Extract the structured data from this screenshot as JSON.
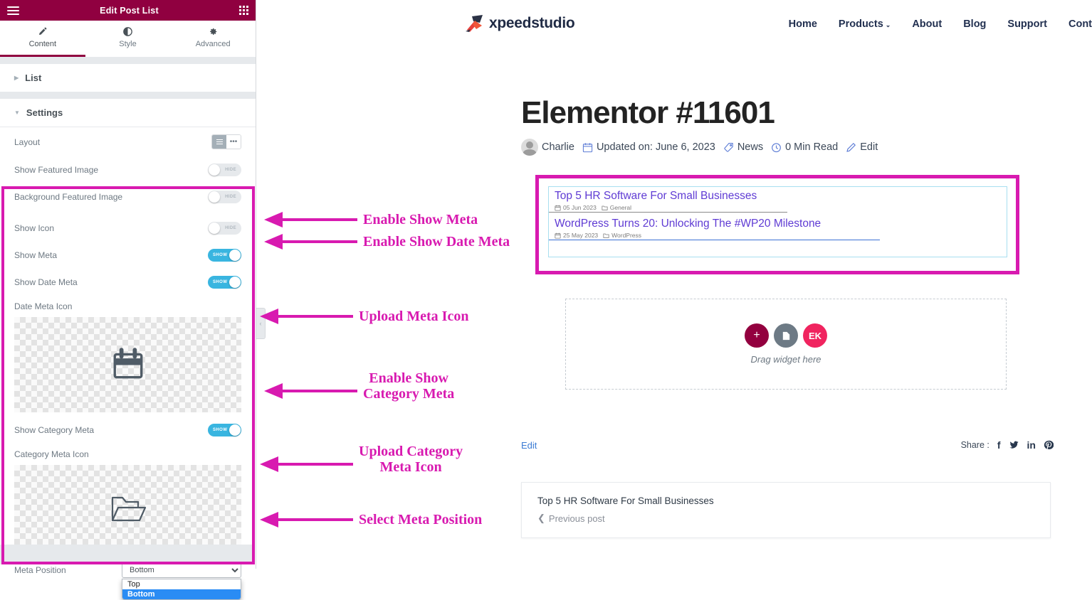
{
  "panel": {
    "title": "Edit Post List",
    "menu_icon": "hamburger-icon",
    "grid_icon": "grid-apps-icon",
    "tabs": [
      {
        "label": "Content",
        "icon": "pencil-icon",
        "active": true
      },
      {
        "label": "Style",
        "icon": "contrast-icon",
        "active": false
      },
      {
        "label": "Advanced",
        "icon": "gear-icon",
        "active": false
      }
    ],
    "sections": [
      {
        "label": "List",
        "expanded": false
      },
      {
        "label": "Settings",
        "expanded": true
      }
    ],
    "controls": {
      "layout": {
        "label": "Layout",
        "options": [
          "list",
          "grid"
        ],
        "selected": "list"
      },
      "show_featured_image": {
        "label": "Show Featured Image",
        "state": "HIDE"
      },
      "background_featured_image": {
        "label": "Background Featured Image",
        "state": "HIDE"
      },
      "show_icon": {
        "label": "Show Icon",
        "state": "HIDE"
      },
      "show_meta": {
        "label": "Show Meta",
        "state": "SHOW"
      },
      "show_date_meta": {
        "label": "Show Date Meta",
        "state": "SHOW"
      },
      "date_meta_icon": {
        "label": "Date Meta Icon",
        "icon": "calendar-icon"
      },
      "show_category_meta": {
        "label": "Show Category Meta",
        "state": "SHOW"
      },
      "category_meta_icon": {
        "label": "Category Meta Icon",
        "icon": "folder-open-icon"
      },
      "meta_position": {
        "label": "Meta Position",
        "value": "Bottom",
        "options": [
          "Top",
          "Bottom"
        ],
        "open": true
      }
    },
    "collapse_handle": "‹",
    "highlight_color": "#d81ab0"
  },
  "annotations": [
    {
      "text": "Enable Show Meta"
    },
    {
      "text": "Enable Show Date Meta"
    },
    {
      "text": "Upload Meta Icon"
    },
    {
      "text": "Enable Show\nCategory Meta"
    },
    {
      "text": "Upload Category\nMeta Icon"
    },
    {
      "text": "Select Meta Position"
    }
  ],
  "site": {
    "logo_text": "xpeedstudio",
    "nav": [
      {
        "label": "Home",
        "dropdown": false
      },
      {
        "label": "Products",
        "dropdown": true
      },
      {
        "label": "About",
        "dropdown": false
      },
      {
        "label": "Blog",
        "dropdown": false
      },
      {
        "label": "Support",
        "dropdown": false
      },
      {
        "label": "Cont",
        "dropdown": false
      }
    ],
    "post": {
      "title": "Elementor #11601",
      "meta": [
        {
          "icon": "avatar-icon",
          "text": "Charlie"
        },
        {
          "icon": "calendar-icon",
          "text": "Updated on: June 6, 2023"
        },
        {
          "icon": "tag-icon",
          "text": "News"
        },
        {
          "icon": "clock-icon",
          "text": "0 Min Read"
        },
        {
          "icon": "pencil-icon",
          "text": "Edit"
        }
      ]
    },
    "post_list": [
      {
        "title": "Top 5 HR Software For Small Businesses",
        "date": "05 Jun 2023",
        "category": "General"
      },
      {
        "title": "WordPress Turns 20: Unlocking The #WP20 Milestone",
        "date": "25 May 2023",
        "category": "WordPress"
      }
    ],
    "dropzone": {
      "label": "Drag widget here",
      "buttons": [
        {
          "name": "add-element-button",
          "glyph": "+"
        },
        {
          "name": "template-button",
          "glyph": "▯"
        },
        {
          "name": "elementskit-button",
          "glyph": "EK"
        }
      ]
    },
    "edit_link": "Edit",
    "share": {
      "label": "Share :",
      "networks": [
        "facebook",
        "twitter",
        "linkedin",
        "pinterest"
      ]
    },
    "previous_post": {
      "title": "Top 5 HR Software For Small Businesses",
      "link": "Previous post"
    }
  }
}
